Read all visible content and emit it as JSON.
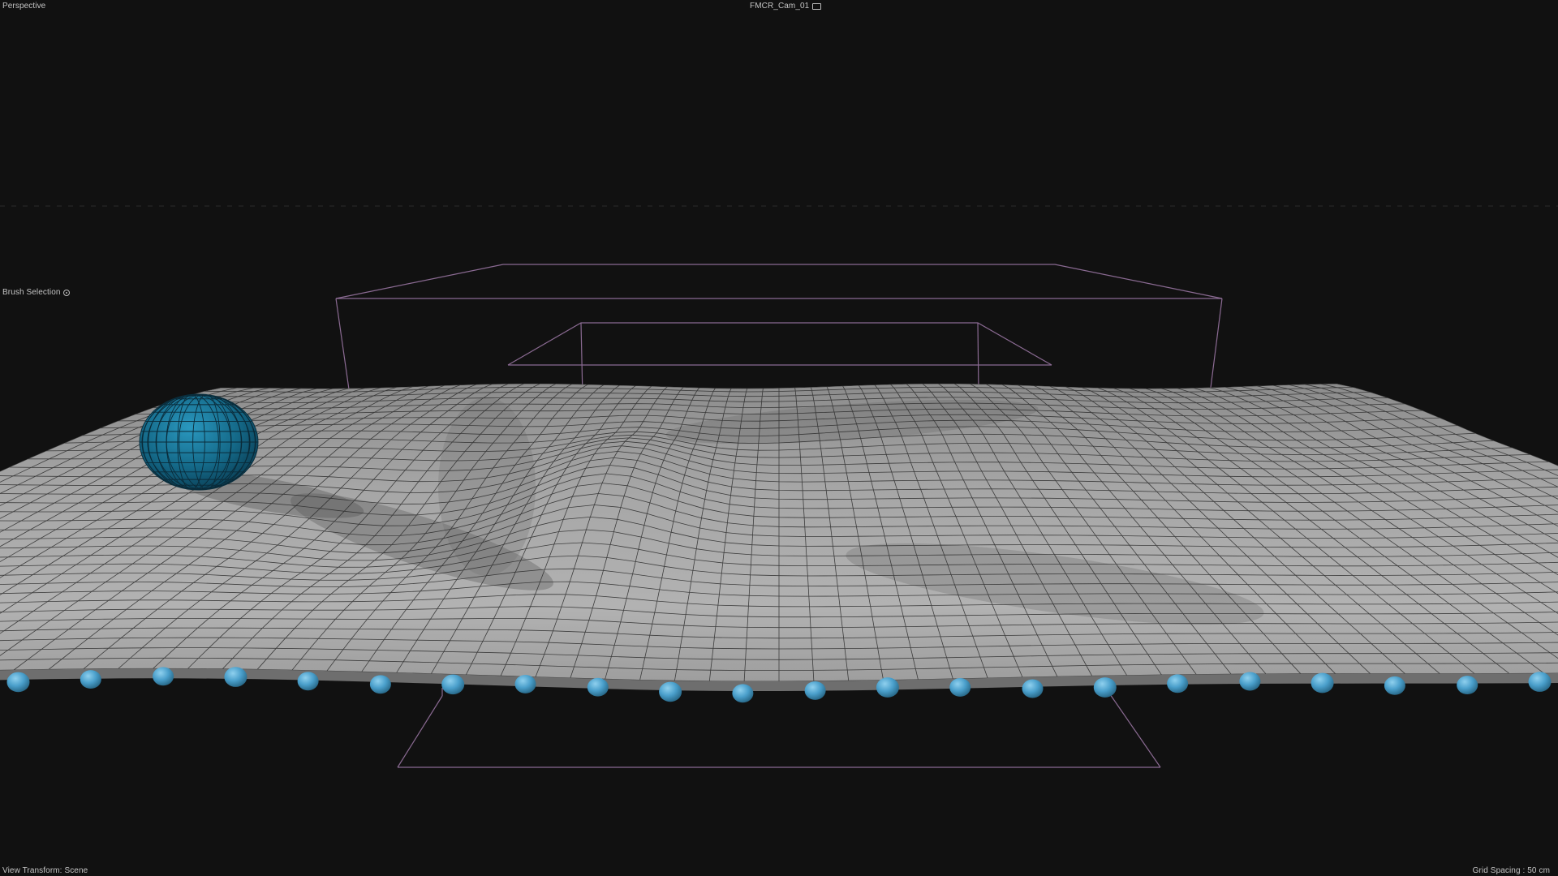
{
  "viewport": {
    "view_name": "Perspective",
    "camera_name": "FMCR_Cam_01",
    "camera_icon": "camera-icon",
    "brush_selection_label": "Brush Selection",
    "brush_icon": "target-dot-icon",
    "view_transform": "View Transform: Scene",
    "grid_spacing": "Grid Spacing : 50 cm"
  },
  "colors": {
    "background": "#111111",
    "mesh_surface": "#9a9a9a",
    "wireframe": "#2a2a2a",
    "bounding_box": "#8a6a92",
    "collider_sphere": "#1d7596",
    "particles": "#4aa0cc"
  }
}
